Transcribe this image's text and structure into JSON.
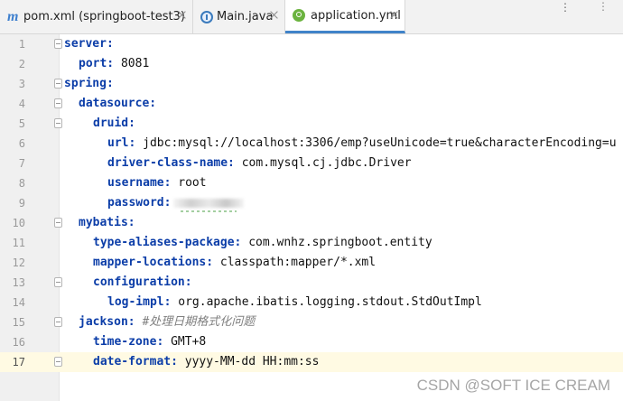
{
  "tabs": [
    {
      "label": "pom.xml (springboot-test3)",
      "icon": "maven-m-icon"
    },
    {
      "label": "Main.java",
      "icon": "java-class-icon"
    },
    {
      "label": "application.yml",
      "icon": "spring-yml-icon",
      "active": true
    }
  ],
  "editor": {
    "current_line": 17,
    "lines": [
      {
        "num": "1",
        "key": "server:",
        "value": ""
      },
      {
        "num": "2",
        "key": "port:",
        "value": " 8081"
      },
      {
        "num": "3",
        "key": "spring:",
        "value": ""
      },
      {
        "num": "4",
        "key": "datasource:",
        "value": ""
      },
      {
        "num": "5",
        "key": "druid:",
        "value": ""
      },
      {
        "num": "6",
        "key": "url:",
        "value": " jdbc:mysql://localhost:3306/emp?useUnicode=true&characterEncoding=u"
      },
      {
        "num": "7",
        "key": "driver-class-name:",
        "value": " com.mysql.cj.jdbc.Driver"
      },
      {
        "num": "8",
        "key": "username:",
        "value": " root"
      },
      {
        "num": "9",
        "key": "password:",
        "value": ""
      },
      {
        "num": "10",
        "key": "mybatis:",
        "value": ""
      },
      {
        "num": "11",
        "key": "type-aliases-package:",
        "value": " com.wnhz.springboot.entity"
      },
      {
        "num": "12",
        "key": "mapper-locations:",
        "value": " classpath:mapper/*.xml"
      },
      {
        "num": "13",
        "key": "configuration:",
        "value": ""
      },
      {
        "num": "14",
        "key": "log-impl:",
        "value": " org.apache.ibatis.logging.stdout.StdOutImpl"
      },
      {
        "num": "15",
        "key": "jackson:",
        "value": " ",
        "comment": "#处理日期格式化问题"
      },
      {
        "num": "16",
        "key": "time-zone:",
        "value": " GMT+8"
      },
      {
        "num": "17",
        "key": "date-format:",
        "value": " yyyy-MM-dd HH:mm:ss"
      }
    ]
  },
  "watermark": "CSDN @SOFT ICE CREAM"
}
